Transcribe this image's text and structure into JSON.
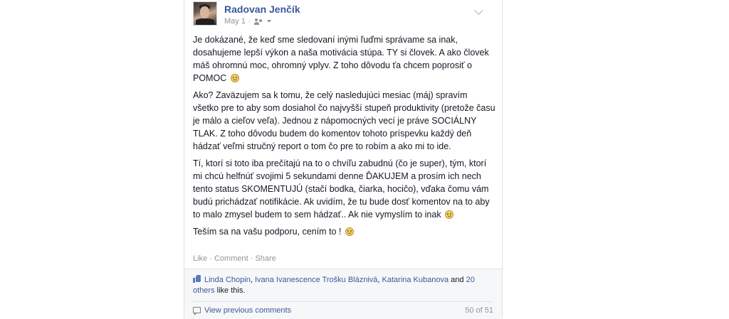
{
  "post": {
    "author": "Radovan Jenčík",
    "date": "May 1",
    "separator": "·",
    "paragraphs": [
      "Je dokázané, že keď sme sledovaní inými ľuďmi správame sa inak, dosahujeme lepší výkon a naša motivácia stúpa. TY si človek. A ako človek máš ohromnú moc, ohromný vplyv. Z toho dôvodu ťa chcem poprosiť o POMOC",
      "Ako? Zaväzujem sa k tomu, že celý nasledujúci mesiac (máj) spravím všetko pre to aby som dosiahol čo najvyšší stupeň produktivity (pretože času je málo a cieľov veľa). Jednou z nápomocných vecí je práve SOCIÁLNY TLAK. Z toho dôvodu budem do komentov tohoto príspevku každý deň hádzať veľmi stručný report o tom čo pre to robím a ako mi to ide.",
      "Tí, ktorí si toto iba prečítajú na to o chvíľu zabudnú (čo je super), tým, ktorí mi chcú helfnúť svojimi 5 sekundami denne ĎAKUJEM a prosím ich nech tento status SKOMENTUJÚ (stačí bodka, čiarka, hocičo), vďaka čomu vám budú prichádzať notifikácie. Ak uvidím, že tu bude dosť komentov na to aby to malo zmysel budem to sem hádzať.. Ak nie vymyslím to inak",
      "Teším sa na vašu podporu, cením to !"
    ]
  },
  "actions": {
    "like": "Like",
    "comment": "Comment",
    "share": "Share",
    "sep": "·"
  },
  "likes": {
    "names": [
      "Linda Chopin",
      "Ivana Ivanescence Trošku Bláznivá",
      "Katarina Kubanova"
    ],
    "comma": ",",
    "and": "and",
    "others_count": "20 others",
    "suffix": "like this."
  },
  "comments": {
    "view_previous": "View previous comments",
    "counter": "50 of 51"
  }
}
